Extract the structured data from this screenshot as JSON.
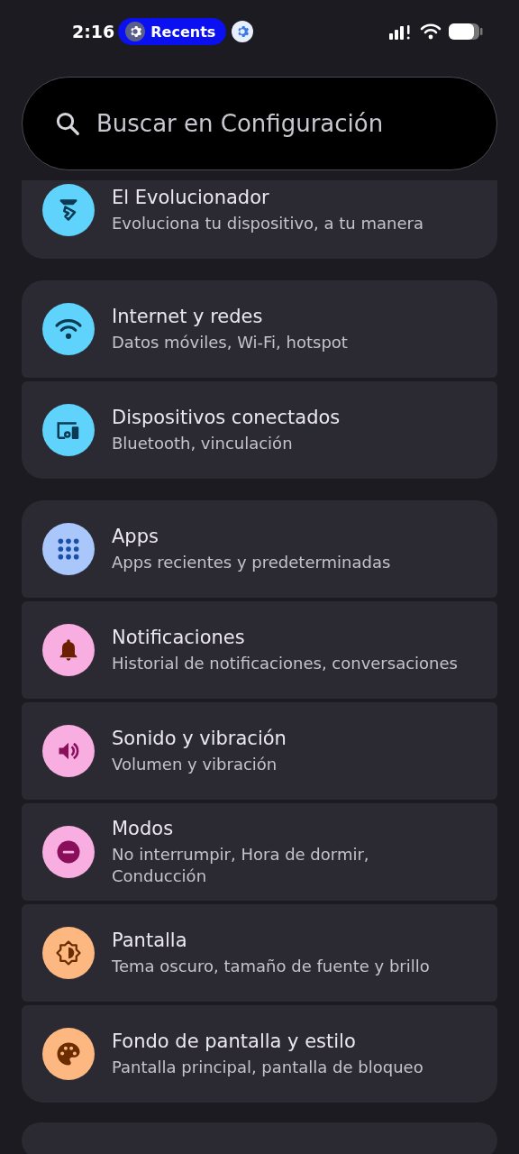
{
  "status_bar": {
    "time": "2:16",
    "app_chip": "Recents"
  },
  "search": {
    "placeholder": "Buscar en Configuración"
  },
  "groups": [
    {
      "clipped": true,
      "items": [
        {
          "title": "El Evolucionador",
          "subtitle": "Evoluciona tu dispositivo, a tu manera",
          "kind": "evolver",
          "color": "#5fd3fb"
        }
      ]
    },
    {
      "clipped": false,
      "items": [
        {
          "title": "Internet y redes",
          "subtitle": "Datos móviles, Wi-Fi, hotspot",
          "kind": "wifi",
          "color": "#5fd3fb"
        },
        {
          "title": "Dispositivos conectados",
          "subtitle": "Bluetooth, vinculación",
          "kind": "devices",
          "color": "#5fd3fb"
        }
      ]
    },
    {
      "clipped": false,
      "items": [
        {
          "title": "Apps",
          "subtitle": "Apps recientes y predeterminadas",
          "kind": "apps",
          "color": "#a9c7fa"
        },
        {
          "title": "Notificaciones",
          "subtitle": "Historial de notificaciones, conversaciones",
          "kind": "bell",
          "color": "#f9aee2"
        },
        {
          "title": "Sonido y vibración",
          "subtitle": "Volumen y vibración",
          "kind": "sound",
          "color": "#f9aee2"
        },
        {
          "title": "Modos",
          "subtitle": "No interrumpir, Hora de dormir, Conducción",
          "kind": "modes",
          "color": "#f9aee2"
        },
        {
          "title": "Pantalla",
          "subtitle": "Tema oscuro, tamaño de fuente y brillo",
          "kind": "display",
          "color": "#fdb882"
        },
        {
          "title": "Fondo de pantalla y estilo",
          "subtitle": "Pantalla principal, pantalla de bloqueo",
          "kind": "palette",
          "color": "#fdb882"
        }
      ]
    }
  ]
}
